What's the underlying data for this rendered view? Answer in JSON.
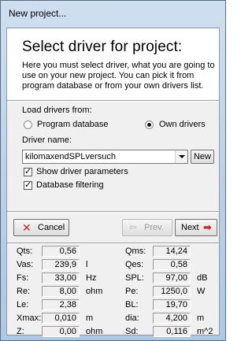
{
  "window": {
    "title": "New project..."
  },
  "header": {
    "heading": "Select driver for project:",
    "description": "Here you must select driver, what you are going to use on your new project. You can pick it from program database or from your own drivers list."
  },
  "load": {
    "label": "Load drivers from:",
    "options": [
      {
        "label": "Program database",
        "selected": false
      },
      {
        "label": "Own drivers",
        "selected": true
      }
    ]
  },
  "driver": {
    "label": "Driver name:",
    "value": "kilomaxendSPLversuch",
    "new_label": "New"
  },
  "checks": [
    {
      "label": "Show driver parameters",
      "checked": true
    },
    {
      "label": "Database filtering",
      "checked": true
    }
  ],
  "buttons": {
    "cancel": "Cancel",
    "prev": "Prev.",
    "next": "Next"
  },
  "params_left": [
    {
      "name": "Qts:",
      "value": "0,56",
      "unit": ""
    },
    {
      "name": "Vas:",
      "value": "239,9",
      "unit": "l"
    },
    {
      "name": "Fs:",
      "value": "33,00",
      "unit": "Hz"
    },
    {
      "name": "Re:",
      "value": "8,00",
      "unit": "ohm"
    },
    {
      "name": "Le:",
      "value": "2,38",
      "unit": ""
    },
    {
      "name": "Xmax:",
      "value": "0,010",
      "unit": "m"
    },
    {
      "name": "Z:",
      "value": "0,00",
      "unit": "ohm"
    }
  ],
  "params_right": [
    {
      "name": "Qms:",
      "value": "14,24",
      "unit": ""
    },
    {
      "name": "Qes:",
      "value": "0,58",
      "unit": ""
    },
    {
      "name": "SPL:",
      "value": "97,00",
      "unit": "dB"
    },
    {
      "name": "Pe:",
      "value": "1250,0",
      "unit": "W"
    },
    {
      "name": "BL:",
      "value": "19,70",
      "unit": ""
    },
    {
      "name": "dia:",
      "value": "4,200",
      "unit": "m"
    },
    {
      "name": "Sd:",
      "value": "0,116",
      "unit": "m^2"
    }
  ]
}
